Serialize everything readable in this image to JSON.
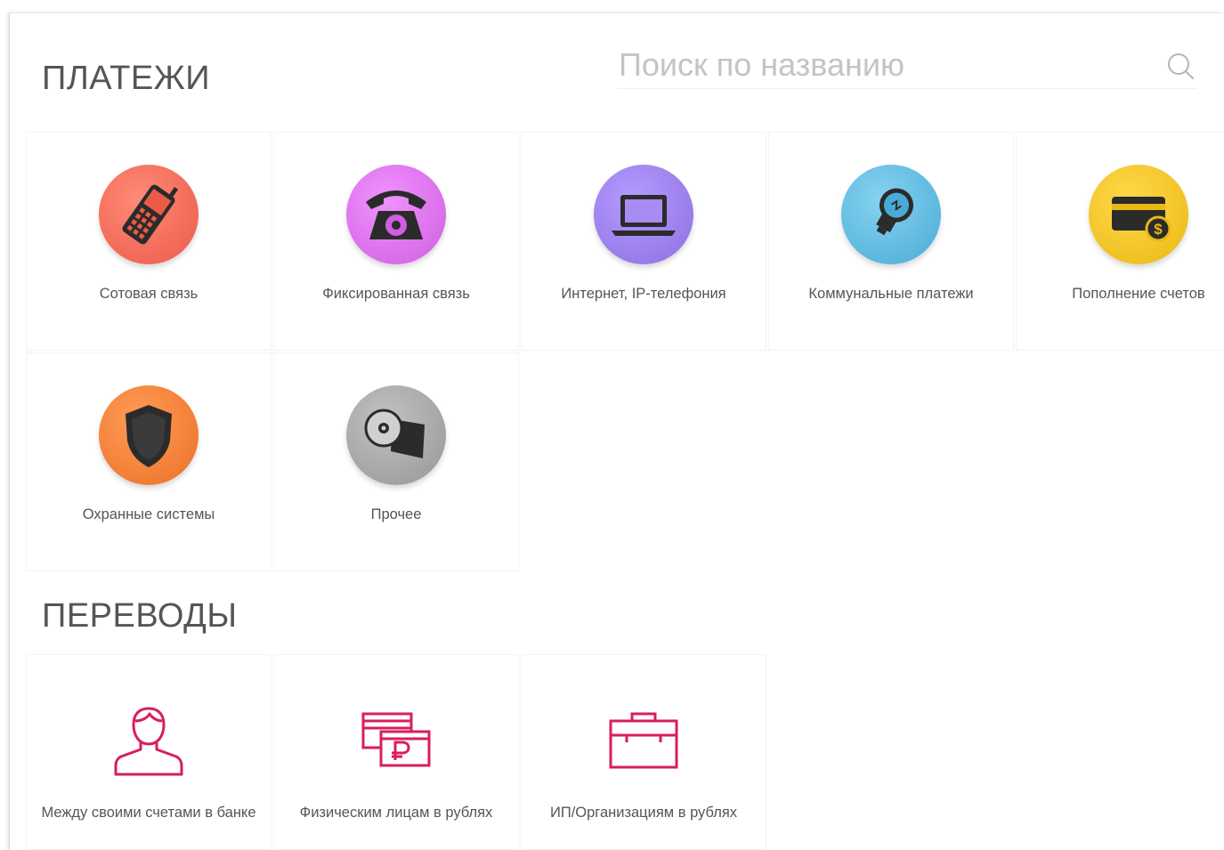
{
  "payments": {
    "title": "ПЛАТЕЖИ",
    "search_placeholder": "Поиск по названию",
    "tiles": [
      {
        "label": "Сотовая связь",
        "icon": "mobile-phone-icon",
        "color": "#f26a57"
      },
      {
        "label": "Фиксированная связь",
        "icon": "rotary-phone-icon",
        "color": "#d86fe6"
      },
      {
        "label": "Интернет, IP-телефония",
        "icon": "laptop-icon",
        "color": "#9a7ce9"
      },
      {
        "label": "Коммунальные платежи",
        "icon": "light-bulb-icon",
        "color": "#5fb7dd"
      },
      {
        "label": "Пополнение счетов",
        "icon": "credit-card-icon",
        "color": "#f2c31f"
      },
      {
        "label": "Охранные системы",
        "icon": "shield-icon",
        "color": "#f2813b"
      },
      {
        "label": "Прочее",
        "icon": "disc-box-icon",
        "color": "#a6a6a6"
      }
    ]
  },
  "transfers": {
    "title": "ПЕРЕВОДЫ",
    "tiles": [
      {
        "label": "Между своими счетами в банке",
        "icon": "person-icon"
      },
      {
        "label": "Физическим лицам в рублях",
        "icon": "ruble-cards-icon"
      },
      {
        "label": "ИП/Организациям в рублях",
        "icon": "briefcase-icon"
      }
    ],
    "accent_color": "#d81e5b"
  }
}
